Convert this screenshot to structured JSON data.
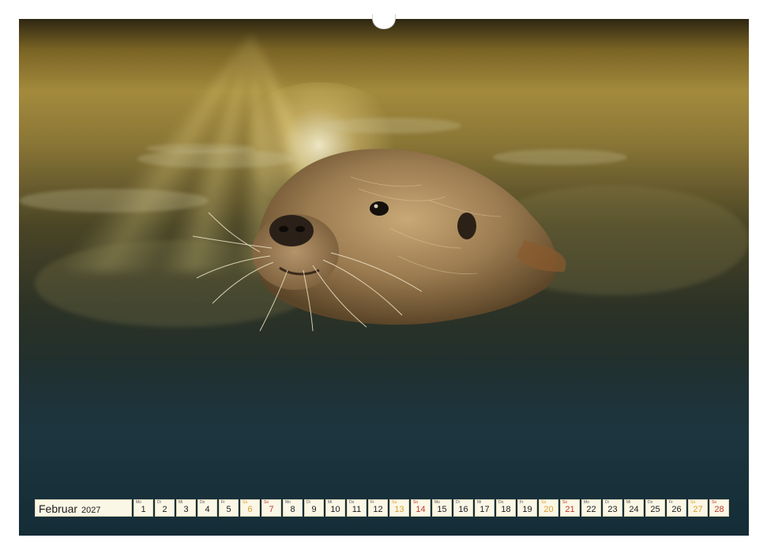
{
  "calendar": {
    "month": "Februar",
    "year": "2027",
    "days": [
      {
        "wd": "Mo",
        "num": "1",
        "type": "weekday"
      },
      {
        "wd": "Di",
        "num": "2",
        "type": "weekday"
      },
      {
        "wd": "Mi",
        "num": "3",
        "type": "weekday"
      },
      {
        "wd": "Do",
        "num": "4",
        "type": "weekday"
      },
      {
        "wd": "Fr",
        "num": "5",
        "type": "weekday"
      },
      {
        "wd": "Sa",
        "num": "6",
        "type": "sat"
      },
      {
        "wd": "So",
        "num": "7",
        "type": "sun"
      },
      {
        "wd": "Mo",
        "num": "8",
        "type": "weekday"
      },
      {
        "wd": "Di",
        "num": "9",
        "type": "weekday"
      },
      {
        "wd": "Mi",
        "num": "10",
        "type": "weekday"
      },
      {
        "wd": "Do",
        "num": "11",
        "type": "weekday"
      },
      {
        "wd": "Fr",
        "num": "12",
        "type": "weekday"
      },
      {
        "wd": "Sa",
        "num": "13",
        "type": "sat"
      },
      {
        "wd": "So",
        "num": "14",
        "type": "sun"
      },
      {
        "wd": "Mo",
        "num": "15",
        "type": "weekday"
      },
      {
        "wd": "Di",
        "num": "16",
        "type": "weekday"
      },
      {
        "wd": "Mi",
        "num": "17",
        "type": "weekday"
      },
      {
        "wd": "Do",
        "num": "18",
        "type": "weekday"
      },
      {
        "wd": "Fr",
        "num": "19",
        "type": "weekday"
      },
      {
        "wd": "Sa",
        "num": "20",
        "type": "sat"
      },
      {
        "wd": "So",
        "num": "21",
        "type": "sun"
      },
      {
        "wd": "Mo",
        "num": "22",
        "type": "weekday"
      },
      {
        "wd": "Di",
        "num": "23",
        "type": "weekday"
      },
      {
        "wd": "Mi",
        "num": "24",
        "type": "weekday"
      },
      {
        "wd": "Do",
        "num": "25",
        "type": "weekday"
      },
      {
        "wd": "Fr",
        "num": "26",
        "type": "weekday"
      },
      {
        "wd": "Sa",
        "num": "27",
        "type": "sat"
      },
      {
        "wd": "So",
        "num": "28",
        "type": "sun"
      }
    ]
  },
  "colors": {
    "saturday": "#d9a031",
    "sunday": "#c0392b",
    "cell_background": "#fbf7e6"
  },
  "icons": {
    "hanger": "wall-hanger-icon"
  }
}
